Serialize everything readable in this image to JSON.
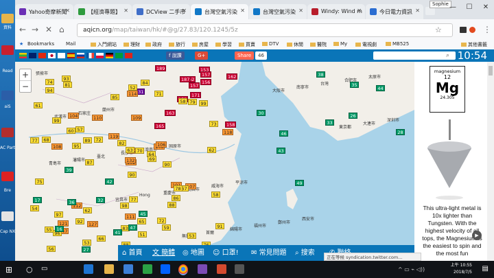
{
  "desktop": {
    "labels": [
      "資料",
      "Read",
      "aiS",
      "AC Parti",
      "Bre",
      "Cap NX"
    ]
  },
  "browser": {
    "tabs": [
      {
        "title": "Yahoo奇摩新聞",
        "fav": "#6b2fb5"
      },
      {
        "title": "【經濟專題】",
        "fav": "#2e9b3e"
      },
      {
        "title": "DCView 二手市",
        "fav": "#3f6ec8"
      },
      {
        "title": "台灣空氣污染",
        "fav": "#1178c7"
      },
      {
        "title": "台灣空氣污染",
        "fav": "#1178c7"
      },
      {
        "title": "Windy: Wind m",
        "fav": "#b81d2b"
      },
      {
        "title": "今日電力資訊",
        "fav": "#2a6dd1"
      }
    ],
    "user_badge": "Sophie",
    "url_host": "aqicn.org",
    "url_path": "/map/taiwan/hk/#@g/27.83/120.1245/5z",
    "bookmarks": [
      "Bookmarks",
      "Mail",
      "入門網站",
      "理財",
      "政府",
      "旅行",
      "房屋",
      "學習",
      "買賣",
      "DTV",
      "休閒",
      "醫院",
      "My",
      "電視劇",
      "MB525",
      "其他書籤"
    ]
  },
  "aqicn": {
    "share_fb": "f 說讚",
    "share_gplus": "G+",
    "share_label": "Share",
    "share_count": "46",
    "clock": "10:54",
    "zoom_in": "+",
    "zoom_out": "−",
    "bottom_menu": [
      "首頁",
      "簡體",
      "地圖",
      "口罩!",
      "常見問題",
      "搜索",
      "聯絡"
    ],
    "status_tip": "正在等候 syndication.twitter.com..."
  },
  "map": {
    "place_labels": [
      "張掖市",
      "蘭州市",
      "固原市",
      "平涼市",
      "西安市",
      "太原市",
      "石家庄",
      "濟南市",
      "威海市",
      "鄭州市",
      "合肥市",
      "武漢市",
      "長沙市",
      "南昌市",
      "福州市",
      "台灣",
      "深圳市",
      "臺北",
      "重慶市",
      "綿陽市",
      "南寧市",
      "大連市",
      "瀋陽市",
      "Hong",
      "首爾",
      "大阪市",
      "東京都",
      "青島市",
      "宜昌市",
      "無錫市"
    ],
    "markers": [
      {
        "v": "90",
        "c": "y"
      },
      {
        "v": "99",
        "c": "y"
      },
      {
        "v": "102",
        "c": "o"
      },
      {
        "v": "121",
        "c": "o"
      },
      {
        "v": "146",
        "c": "o"
      },
      {
        "v": "163",
        "c": "r"
      },
      {
        "v": "153",
        "c": "r"
      },
      {
        "v": "162",
        "c": "r"
      },
      {
        "v": "157",
        "c": "r"
      },
      {
        "v": "171",
        "c": "r"
      },
      {
        "v": "189",
        "c": "r"
      },
      {
        "v": "158",
        "c": "r"
      },
      {
        "v": "231",
        "c": "p"
      },
      {
        "v": "162",
        "c": "r"
      },
      {
        "v": "151",
        "c": "r"
      },
      {
        "v": "156",
        "c": "r"
      },
      {
        "v": "165",
        "c": "r"
      },
      {
        "v": "187",
        "c": "r"
      },
      {
        "v": "157",
        "c": "r"
      },
      {
        "v": "112",
        "c": "o"
      },
      {
        "v": "119",
        "c": "o"
      },
      {
        "v": "147",
        "c": "o"
      },
      {
        "v": "127",
        "c": "o"
      },
      {
        "v": "109",
        "c": "o"
      },
      {
        "v": "106",
        "c": "o"
      },
      {
        "v": "107",
        "c": "o"
      },
      {
        "v": "104",
        "c": "o"
      },
      {
        "v": "114",
        "c": "o"
      },
      {
        "v": "108",
        "c": "o"
      },
      {
        "v": "101",
        "c": "o"
      },
      {
        "v": "118",
        "c": "o"
      },
      {
        "v": "132",
        "c": "o"
      },
      {
        "v": "111",
        "c": "o"
      },
      {
        "v": "102",
        "c": "o"
      },
      {
        "v": "110",
        "c": "o"
      },
      {
        "v": "58",
        "c": "y"
      },
      {
        "v": "62",
        "c": "y"
      },
      {
        "v": "76",
        "c": "y"
      },
      {
        "v": "91",
        "c": "y"
      },
      {
        "v": "67",
        "c": "y"
      },
      {
        "v": "84",
        "c": "y"
      },
      {
        "v": "72",
        "c": "y"
      },
      {
        "v": "95",
        "c": "y"
      },
      {
        "v": "88",
        "c": "y"
      },
      {
        "v": "53",
        "c": "y"
      },
      {
        "v": "77",
        "c": "y"
      },
      {
        "v": "64",
        "c": "y"
      },
      {
        "v": "56",
        "c": "y"
      },
      {
        "v": "83",
        "c": "y"
      },
      {
        "v": "69",
        "c": "y"
      },
      {
        "v": "97",
        "c": "y"
      },
      {
        "v": "73",
        "c": "y"
      },
      {
        "v": "61",
        "c": "y"
      },
      {
        "v": "86",
        "c": "y"
      },
      {
        "v": "59",
        "c": "y"
      },
      {
        "v": "92",
        "c": "y"
      },
      {
        "v": "81",
        "c": "y"
      },
      {
        "v": "74",
        "c": "y"
      },
      {
        "v": "65",
        "c": "y"
      },
      {
        "v": "99",
        "c": "y"
      },
      {
        "v": "52",
        "c": "y"
      },
      {
        "v": "87",
        "c": "y"
      },
      {
        "v": "68",
        "c": "y"
      },
      {
        "v": "57",
        "c": "y"
      },
      {
        "v": "79",
        "c": "y"
      },
      {
        "v": "93",
        "c": "y"
      },
      {
        "v": "71",
        "c": "y"
      },
      {
        "v": "85",
        "c": "y"
      },
      {
        "v": "63",
        "c": "y"
      },
      {
        "v": "54",
        "c": "y"
      },
      {
        "v": "98",
        "c": "y"
      },
      {
        "v": "66",
        "c": "y"
      },
      {
        "v": "78",
        "c": "y"
      },
      {
        "v": "89",
        "c": "y"
      },
      {
        "v": "55",
        "c": "y"
      },
      {
        "v": "94",
        "c": "y"
      },
      {
        "v": "60",
        "c": "y"
      },
      {
        "v": "75",
        "c": "y"
      },
      {
        "v": "82",
        "c": "y"
      },
      {
        "v": "51",
        "c": "y"
      },
      {
        "v": "70",
        "c": "y"
      },
      {
        "v": "96",
        "c": "y"
      },
      {
        "v": "90",
        "c": "y"
      },
      {
        "v": "58",
        "c": "y"
      },
      {
        "v": "88",
        "c": "y"
      },
      {
        "v": "62",
        "c": "y"
      },
      {
        "v": "77",
        "c": "y"
      },
      {
        "v": "53",
        "c": "y"
      },
      {
        "v": "84",
        "c": "y"
      },
      {
        "v": "72",
        "c": "y"
      },
      {
        "v": "38",
        "c": "g"
      },
      {
        "v": "45",
        "c": "g"
      },
      {
        "v": "26",
        "c": "g"
      },
      {
        "v": "41",
        "c": "g"
      },
      {
        "v": "33",
        "c": "g"
      },
      {
        "v": "47",
        "c": "g"
      },
      {
        "v": "30",
        "c": "g"
      },
      {
        "v": "27",
        "c": "g"
      },
      {
        "v": "35",
        "c": "g"
      },
      {
        "v": "42",
        "c": "g"
      },
      {
        "v": "46",
        "c": "g"
      },
      {
        "v": "39",
        "c": "g"
      },
      {
        "v": "28",
        "c": "g"
      },
      {
        "v": "17",
        "c": "g"
      },
      {
        "v": "43",
        "c": "g"
      },
      {
        "v": "16",
        "c": "g"
      },
      {
        "v": "49",
        "c": "g"
      },
      {
        "v": "32",
        "c": "g"
      },
      {
        "v": "44",
        "c": "g"
      },
      {
        "v": "36",
        "c": "g"
      }
    ]
  },
  "ad": {
    "element_name": "magnesium",
    "atomic_number": "12",
    "symbol": "Mg",
    "atomic_mass": "24.305",
    "text": "This ultra-light metal is 10x lighter than Tungsten. With the highest velocity of all tops, the Magnesium is the easiest to spin and the most fun"
  },
  "taskbar": {
    "time": "上午 10:55",
    "date": "2018/7/5"
  }
}
